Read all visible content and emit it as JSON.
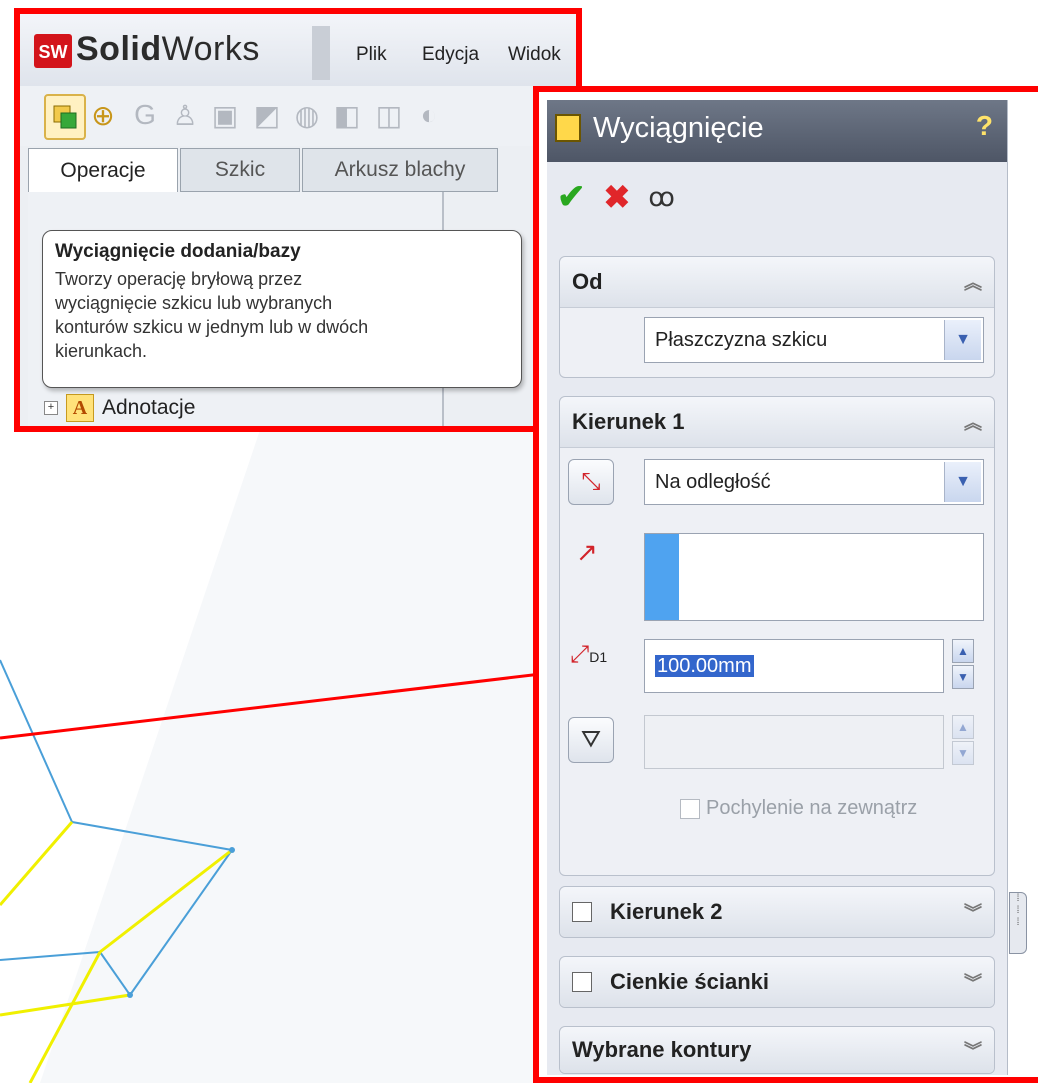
{
  "app": {
    "brand_bold": "Solid",
    "brand_light": "Works",
    "logo_text": "SW",
    "menu": [
      "Plik",
      "Edycja",
      "Widok"
    ]
  },
  "tabs": [
    "Operacje",
    "Szkic",
    "Arkusz blachy"
  ],
  "tooltip": {
    "title": "Wyciągnięcie dodania/bazy",
    "lines": [
      "Tworzy operację bryłową przez",
      "wyciągnięcie szkicu lub wybranych",
      "konturów szkicu w jednym lub w dwóch",
      "kierunkach."
    ]
  },
  "tree": {
    "adnotacje": "Adnotacje",
    "annot_icon_letter": "A"
  },
  "property_manager": {
    "title": "Wyciągnięcie",
    "help": "?",
    "groups": {
      "od": {
        "label": "Od",
        "value": "Płaszczyzna szkicu"
      },
      "kierunek1": {
        "label": "Kierunek 1",
        "end_condition": "Na odległość",
        "depth": "100.00mm",
        "draft_outward": "Pochylenie na zewnątrz",
        "depth_icon_label": "D1"
      },
      "kierunek2": {
        "label": "Kierunek 2"
      },
      "cienkie": {
        "label": "Cienkie ścianki"
      },
      "kontury": {
        "label": "Wybrane kontury"
      }
    }
  },
  "colors": {
    "highlight_red": "#ff0000",
    "sketch_yellow": "#f0f000",
    "edge_blue": "#4a9fd8",
    "selection_blue": "#4fa3f0"
  }
}
